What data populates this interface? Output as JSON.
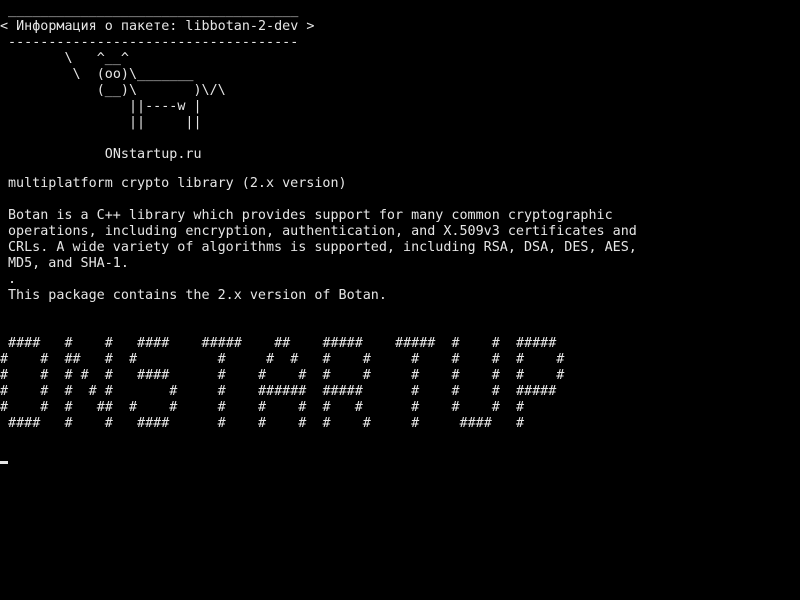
{
  "terminal": {
    "cowsay": [
      " ____________________________________",
      "< Информация о пакете: libbotan-2-dev >",
      " ------------------------------------",
      "        \\   ^__^",
      "         \\  (oo)\\_______",
      "            (__)\\       )\\/\\",
      "                ||----w |",
      "                ||     ||",
      "",
      "             ONstartup.ru"
    ],
    "summary": "multiplatform crypto library (2.x version)",
    "description": [
      "Botan is a C++ library which provides support for many common cryptographic",
      "operations, including encryption, authentication, and X.509v3 certificates and",
      "CRLs. A wide variety of algorithms is supported, including RSA, DSA, DES, AES,",
      "MD5, and SHA-1.",
      ".",
      "This package contains the 2.x version of Botan."
    ],
    "banner": [
      " ####   #    #   ####    #####    ##    #####    #####  #    #  #####",
      "#    #  ##   #  #          #     #  #   #    #     #    #    #  #    #",
      "#    #  # #  #   ####      #    #    #  #    #     #    #    #  #    #",
      "#    #  #  # #       #     #    ######  #####      #    #    #  #####",
      "#    #  #   ##  #    #     #    #    #  #   #      #    #    #  #",
      " ####   #    #   ####      #    #    #  #    #     #     ####   #"
    ]
  }
}
